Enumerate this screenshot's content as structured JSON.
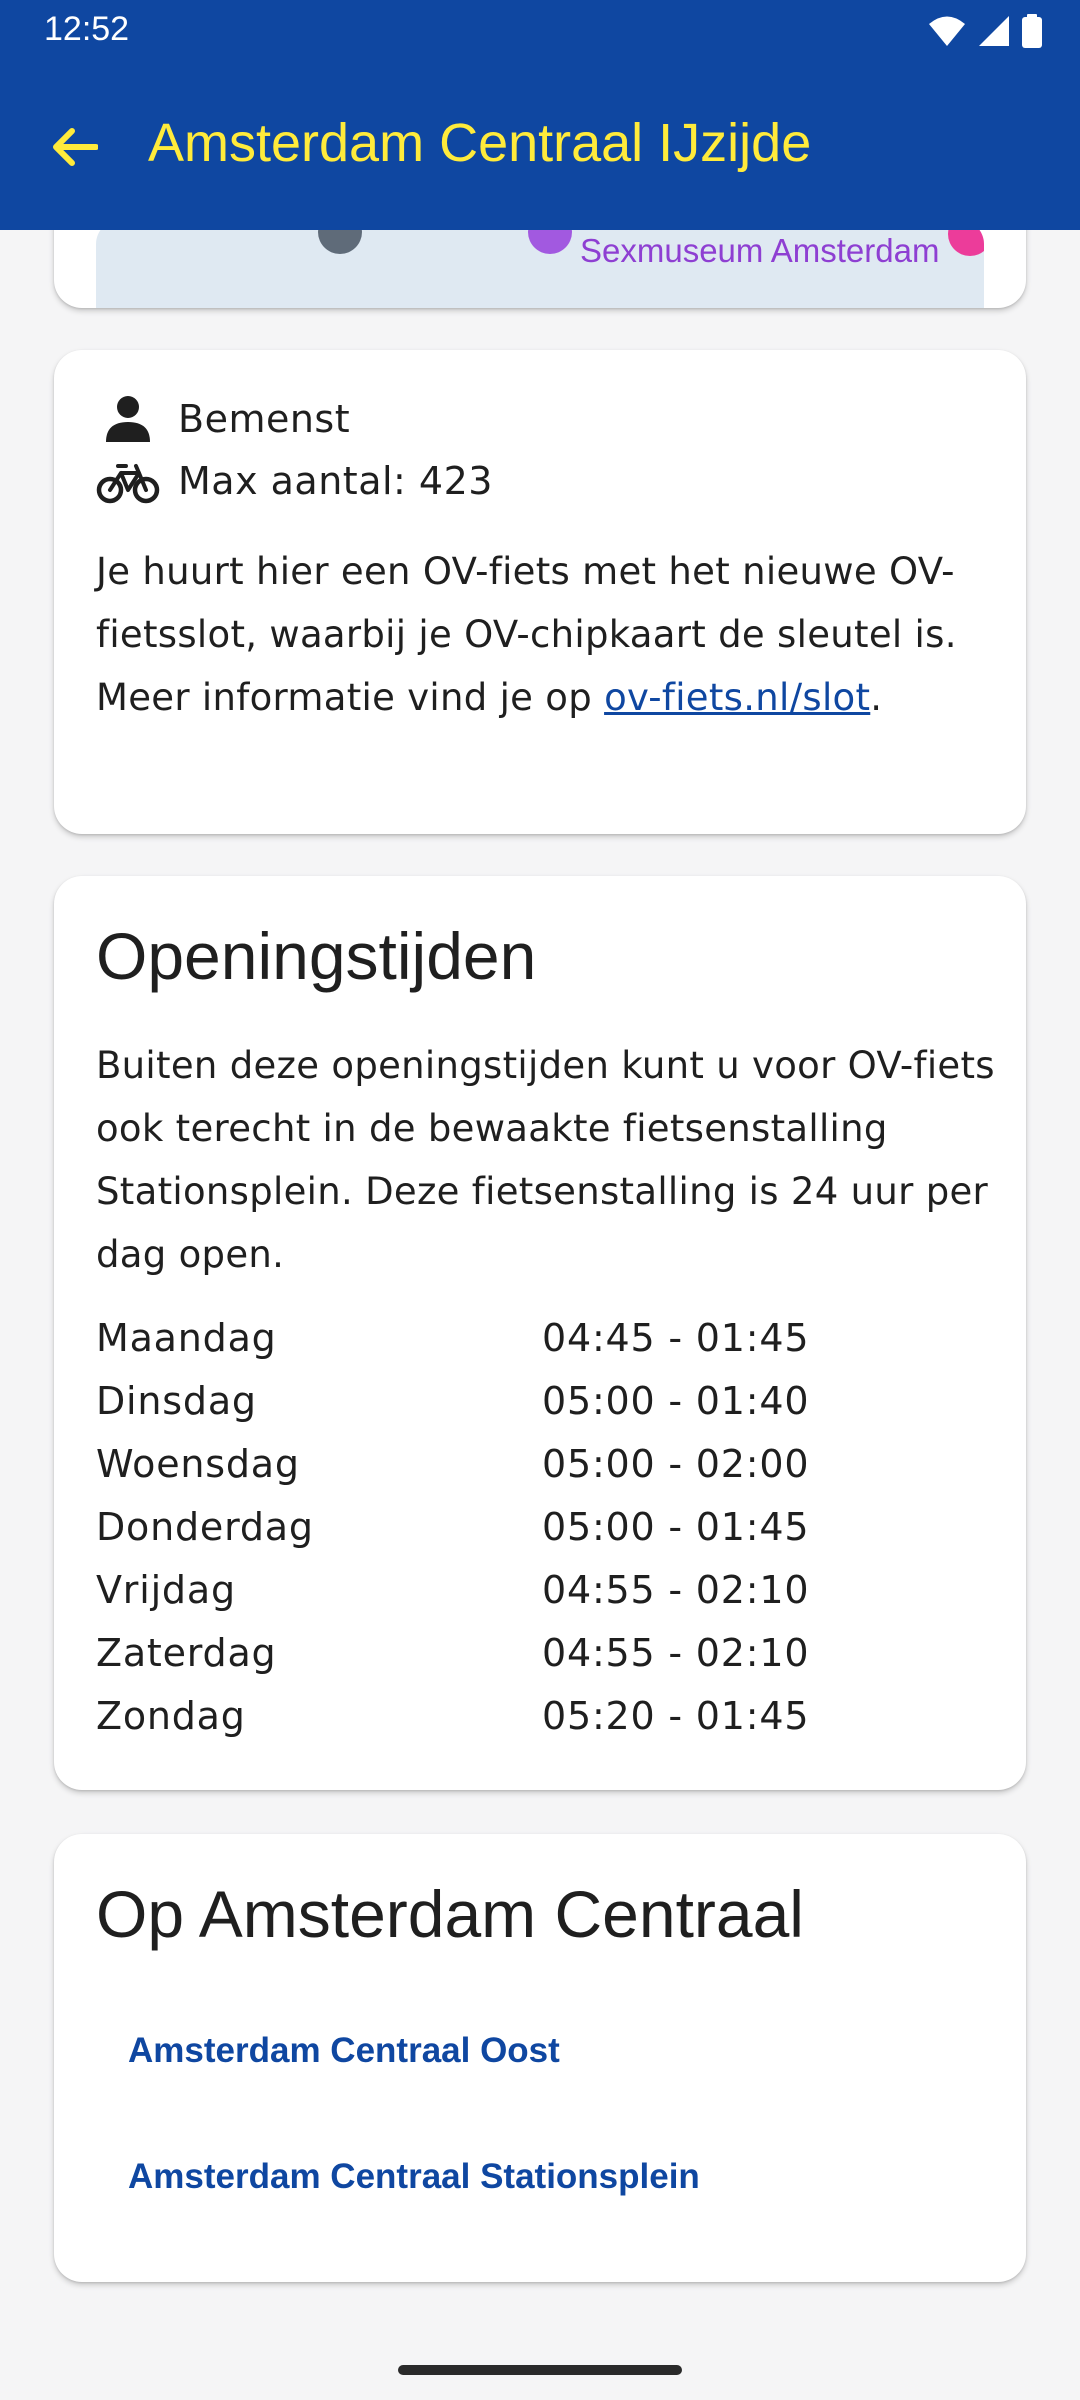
{
  "status": {
    "time": "12:52"
  },
  "header": {
    "title": "Amsterdam Centraal IJzijde",
    "back_icon": "arrow-left-icon"
  },
  "map": {
    "label": "Sexmuseum Amsterdam"
  },
  "info": {
    "staffed_label": "Bemenst",
    "capacity_label": "Max aantal: 423",
    "description_text": "Je huurt hier een OV-fiets met het nieuwe OV-fietsslot, waarbij je OV-chipkaart de sleutel is. Meer informatie vind je op ",
    "link_text": "ov-fiets.nl/slot",
    "description_end": "."
  },
  "hours": {
    "title": "Openingstijden",
    "description": "Buiten deze openingstijden kunt u voor OV-fiets ook terecht in de bewaakte fietsenstalling Stationsplein. Deze fietsenstalling is 24 uur per dag open.",
    "rows": [
      {
        "day": "Maandag",
        "time": "04:45 - 01:45"
      },
      {
        "day": "Dinsdag",
        "time": "05:00 - 01:40"
      },
      {
        "day": "Woensdag",
        "time": "05:00 - 02:00"
      },
      {
        "day": "Donderdag",
        "time": "05:00 - 01:45"
      },
      {
        "day": "Vrijdag",
        "time": "04:55 - 02:10"
      },
      {
        "day": "Zaterdag",
        "time": "04:55 - 02:10"
      },
      {
        "day": "Zondag",
        "time": "05:20 - 01:45"
      }
    ]
  },
  "stations": {
    "title": "Op Amsterdam Centraal",
    "links": [
      "Amsterdam Centraal Oost",
      "Amsterdam Centraal Stationsplein"
    ]
  },
  "colors": {
    "primary": "#0f47a1",
    "title_yellow": "#ffeb3b",
    "map_label": "#8e3fd2"
  }
}
